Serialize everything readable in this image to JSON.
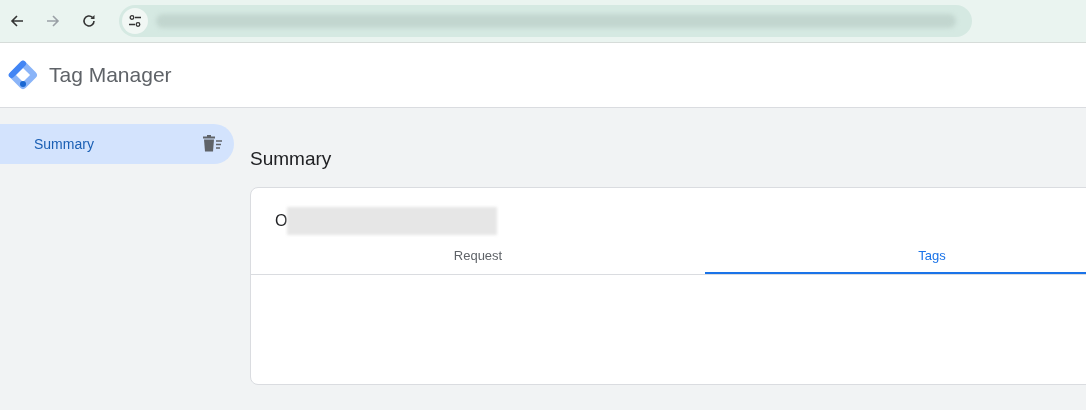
{
  "browser": {
    "back_enabled": true,
    "forward_enabled": false
  },
  "app": {
    "title": "Tag Manager"
  },
  "sidebar": {
    "items": [
      {
        "label": "Summary",
        "selected": true
      }
    ]
  },
  "main": {
    "heading": "Summary",
    "card": {
      "title_initial": "O",
      "tabs": [
        {
          "label": "Request",
          "selected": false
        },
        {
          "label": "Tags",
          "selected": true
        }
      ]
    }
  }
}
